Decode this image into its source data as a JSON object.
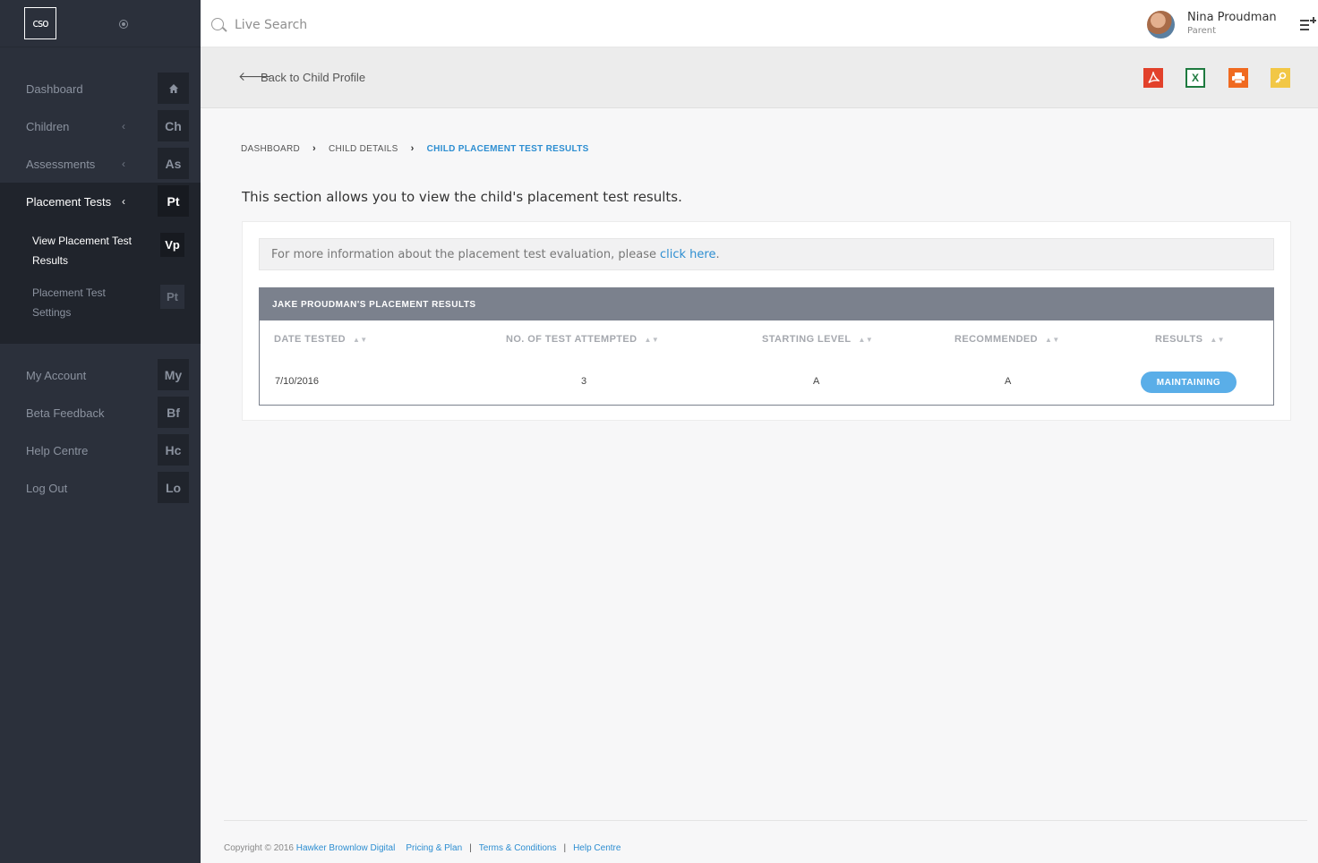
{
  "app": {
    "logo_text": "cso"
  },
  "sidebar": {
    "items": [
      {
        "label": "Dashboard",
        "badge": ""
      },
      {
        "label": "Children",
        "badge": "Ch"
      },
      {
        "label": "Assessments",
        "badge": "As"
      },
      {
        "label": "Placement Tests",
        "badge": "Pt"
      }
    ],
    "subitems": [
      {
        "label": "View Placement Test Results",
        "badge": "Vp"
      },
      {
        "label": "Placement Test Settings",
        "badge": "Pt"
      }
    ],
    "items2": [
      {
        "label": "My Account",
        "badge": "My"
      },
      {
        "label": "Beta Feedback",
        "badge": "Bf"
      },
      {
        "label": "Help Centre",
        "badge": "Hc"
      },
      {
        "label": "Log Out",
        "badge": "Lo"
      }
    ]
  },
  "header": {
    "search_placeholder": "Live Search",
    "user_name": "Nina Proudman",
    "user_role": "Parent"
  },
  "toolbar": {
    "back_label": "Back to Child Profile",
    "export_icons": [
      "pdf-icon",
      "excel-icon",
      "print-icon",
      "key-icon"
    ]
  },
  "breadcrumb": [
    "DASHBOARD",
    "CHILD DETAILS",
    "CHILD PLACEMENT TEST RESULTS"
  ],
  "main": {
    "intro": "This section allows you to view the child's placement test results.",
    "info_text": "For more information about the placement test evaluation, please",
    "info_link": "click here",
    "info_end": ".",
    "table_title": "JAKE PROUDMAN'S PLACEMENT RESULTS",
    "columns": [
      "DATE TESTED",
      "NO. OF TEST ATTEMPTED",
      "STARTING LEVEL",
      "RECOMMENDED",
      "RESULTS"
    ],
    "rows": [
      {
        "date": "7/10/2016",
        "attempts": "3",
        "starting": "A",
        "recommended": "A",
        "result": "MAINTAINING"
      }
    ]
  },
  "footer": {
    "copyright": "Copyright © 2016",
    "company": "Hawker Brownlow Digital",
    "links": [
      "Pricing & Plan",
      "Terms & Conditions",
      "Help Centre"
    ],
    "separator": "|"
  },
  "colors": {
    "sidebar_bg": "#2b303b",
    "accent": "#2d8ed1",
    "status_pill": "#5aaee8",
    "table_header": "#7b818d"
  }
}
